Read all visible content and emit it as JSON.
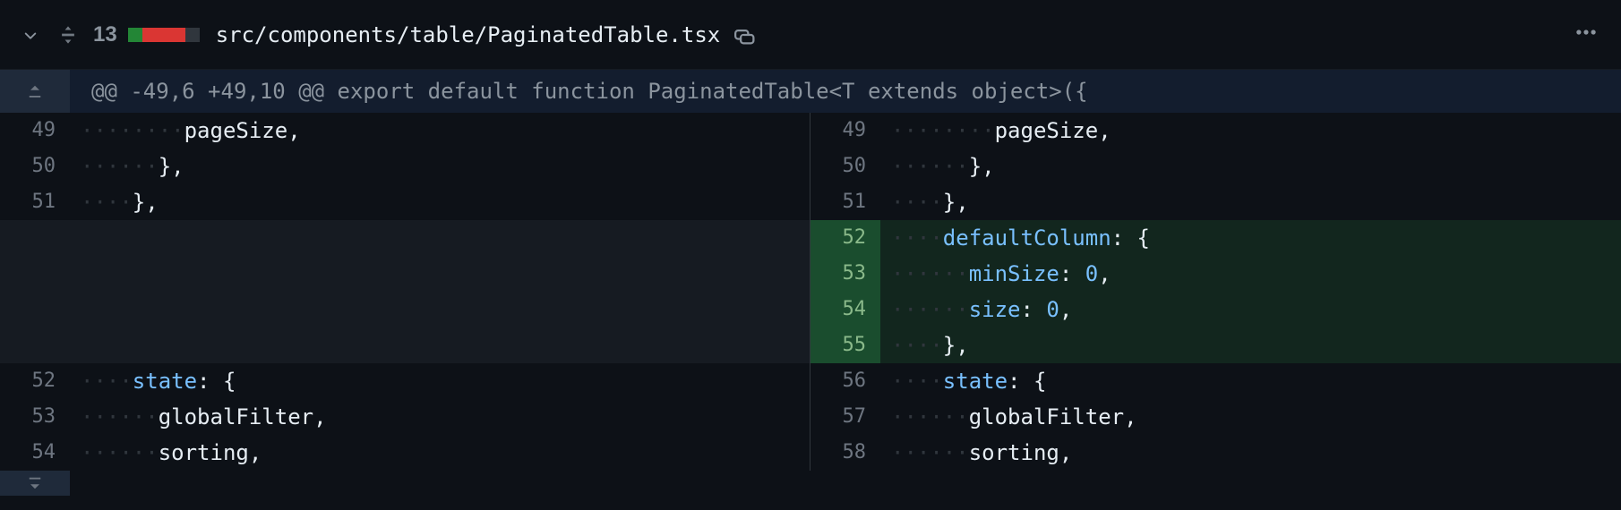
{
  "header": {
    "comment_count": "13",
    "diff_squares": [
      "green",
      "red",
      "red",
      "red",
      "gray"
    ],
    "filepath": "src/components/table/PaginatedTable.tsx"
  },
  "hunk": {
    "text": "@@ -49,6 +49,10 @@ export default function PaginatedTable<T extends object>({"
  },
  "left": [
    {
      "n": "49",
      "type": "ctx",
      "indent": 8,
      "tokens": [
        {
          "t": "pageSize",
          "c": "plain"
        },
        {
          "t": ",",
          "c": "plain"
        }
      ]
    },
    {
      "n": "50",
      "type": "ctx",
      "indent": 6,
      "tokens": [
        {
          "t": "},",
          "c": "plain"
        }
      ]
    },
    {
      "n": "51",
      "type": "ctx",
      "indent": 4,
      "tokens": [
        {
          "t": "},",
          "c": "plain"
        }
      ]
    },
    {
      "n": "",
      "type": "empty"
    },
    {
      "n": "",
      "type": "empty"
    },
    {
      "n": "",
      "type": "empty"
    },
    {
      "n": "",
      "type": "empty"
    },
    {
      "n": "52",
      "type": "ctx",
      "indent": 4,
      "tokens": [
        {
          "t": "state",
          "c": "key"
        },
        {
          "t": ": {",
          "c": "plain"
        }
      ]
    },
    {
      "n": "53",
      "type": "ctx",
      "indent": 6,
      "tokens": [
        {
          "t": "globalFilter,",
          "c": "plain"
        }
      ]
    },
    {
      "n": "54",
      "type": "ctx",
      "indent": 6,
      "tokens": [
        {
          "t": "sorting,",
          "c": "plain"
        }
      ]
    }
  ],
  "right": [
    {
      "n": "49",
      "type": "ctx",
      "indent": 8,
      "tokens": [
        {
          "t": "pageSize",
          "c": "plain"
        },
        {
          "t": ",",
          "c": "plain"
        }
      ]
    },
    {
      "n": "50",
      "type": "ctx",
      "indent": 6,
      "tokens": [
        {
          "t": "},",
          "c": "plain"
        }
      ]
    },
    {
      "n": "51",
      "type": "ctx",
      "indent": 4,
      "tokens": [
        {
          "t": "},",
          "c": "plain"
        }
      ]
    },
    {
      "n": "52",
      "type": "add",
      "indent": 4,
      "tokens": [
        {
          "t": "defaultColumn",
          "c": "key"
        },
        {
          "t": ": {",
          "c": "plain"
        }
      ]
    },
    {
      "n": "53",
      "type": "add",
      "indent": 6,
      "tokens": [
        {
          "t": "minSize",
          "c": "key"
        },
        {
          "t": ": ",
          "c": "plain"
        },
        {
          "t": "0",
          "c": "num"
        },
        {
          "t": ",",
          "c": "plain"
        }
      ]
    },
    {
      "n": "54",
      "type": "add",
      "indent": 6,
      "tokens": [
        {
          "t": "size",
          "c": "key"
        },
        {
          "t": ": ",
          "c": "plain"
        },
        {
          "t": "0",
          "c": "num"
        },
        {
          "t": ",",
          "c": "plain"
        }
      ]
    },
    {
      "n": "55",
      "type": "add",
      "indent": 4,
      "tokens": [
        {
          "t": "},",
          "c": "plain"
        }
      ]
    },
    {
      "n": "56",
      "type": "ctx",
      "indent": 4,
      "tokens": [
        {
          "t": "state",
          "c": "key"
        },
        {
          "t": ": {",
          "c": "plain"
        }
      ]
    },
    {
      "n": "57",
      "type": "ctx",
      "indent": 6,
      "tokens": [
        {
          "t": "globalFilter,",
          "c": "plain"
        }
      ]
    },
    {
      "n": "58",
      "type": "ctx",
      "indent": 6,
      "tokens": [
        {
          "t": "sorting,",
          "c": "plain"
        }
      ]
    }
  ]
}
